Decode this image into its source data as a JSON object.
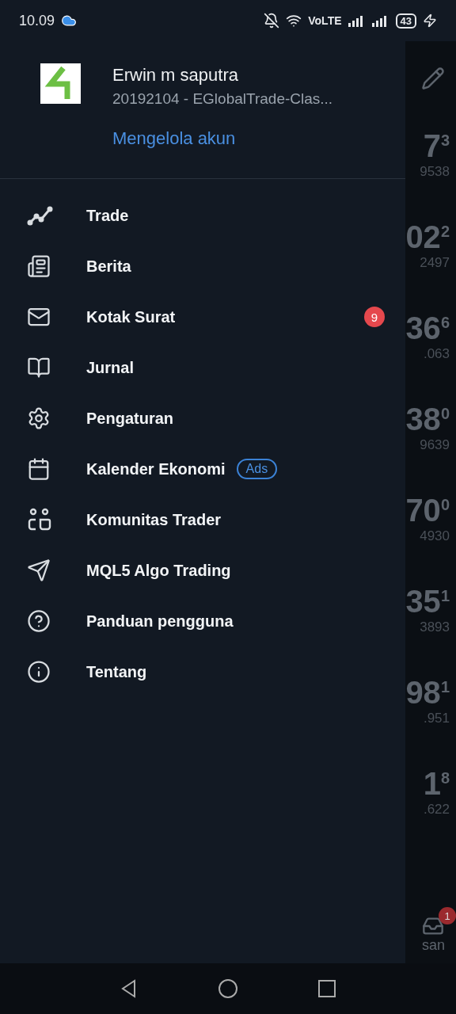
{
  "status_bar": {
    "time": "10.09",
    "network": "VoLTE",
    "battery": "43"
  },
  "account": {
    "name": "Erwin m saputra",
    "server": "20192104 - EGlobalTrade-Clas...",
    "manage_link": "Mengelola akun"
  },
  "menu": [
    {
      "kind": "trade",
      "label": "Trade"
    },
    {
      "kind": "news",
      "label": "Berita"
    },
    {
      "kind": "mail",
      "label": "Kotak Surat",
      "badge": "9"
    },
    {
      "kind": "journal",
      "label": "Jurnal"
    },
    {
      "kind": "settings",
      "label": "Pengaturan"
    },
    {
      "kind": "calendar",
      "label": "Kalender Ekonomi",
      "tag": "Ads"
    },
    {
      "kind": "community",
      "label": "Komunitas Trader"
    },
    {
      "kind": "algo",
      "label": "MQL5 Algo Trading"
    },
    {
      "kind": "help",
      "label": "Panduan pengguna"
    },
    {
      "kind": "about",
      "label": "Tentang"
    }
  ],
  "background_quotes": [
    {
      "price": "7",
      "digit": "3",
      "small": "9538"
    },
    {
      "price": "02",
      "digit": "2",
      "small": "2497"
    },
    {
      "price": "36",
      "digit": "6",
      "small": ".063"
    },
    {
      "price": "38",
      "digit": "0",
      "small": "9639"
    },
    {
      "price": "70",
      "digit": "0",
      "small": "4930"
    },
    {
      "price": "35",
      "digit": "1",
      "small": "3893"
    },
    {
      "price": "98",
      "digit": "1",
      "small": ".951"
    },
    {
      "price": "1",
      "digit": "8",
      "small": ".622"
    }
  ],
  "background_tab": {
    "label": "san",
    "badge": "1"
  }
}
